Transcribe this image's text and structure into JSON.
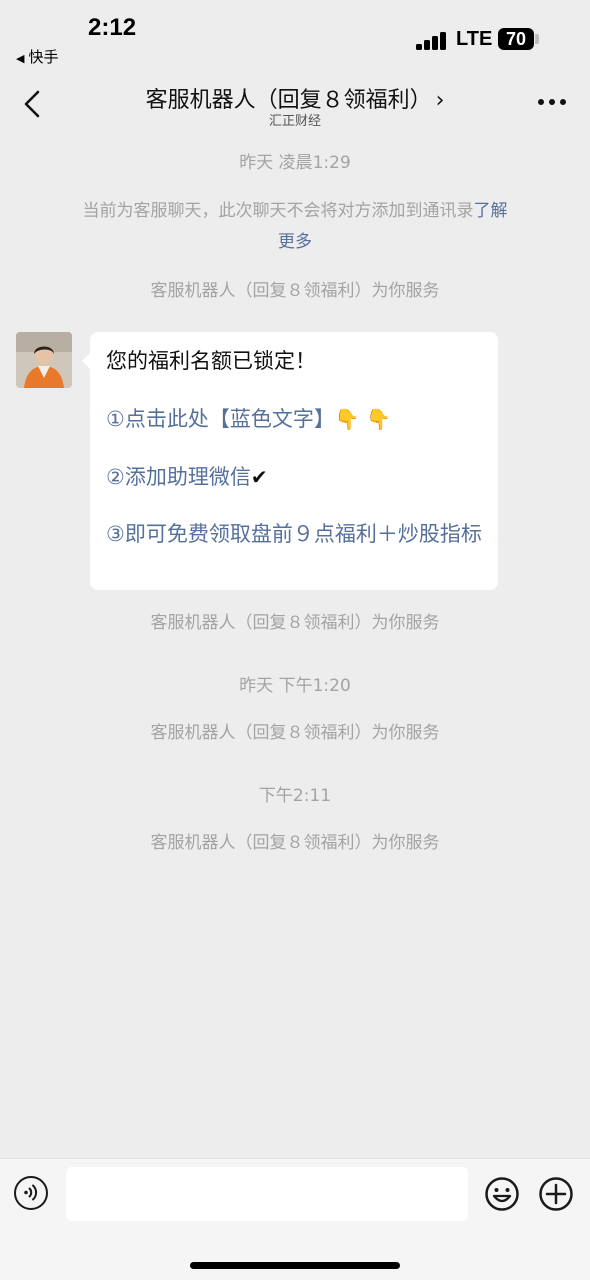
{
  "status_bar": {
    "time": "2:12",
    "back_app": "快手",
    "network": "LTE",
    "battery": "70"
  },
  "nav": {
    "title": "客服机器人（回复８领福利）",
    "chevron": "›",
    "subtitle": "汇正财经"
  },
  "chat": {
    "timestamp_1": "昨天 凌晨1:29",
    "notice_text": "当前为客服聊天，此次聊天不会将对方添加到通讯录",
    "notice_link_1": "了解",
    "notice_link_2": "更多",
    "service_note": "客服机器人（回复８领福利）为你服务",
    "message": {
      "line_1": "您的福利名额已锁定！",
      "line_2": "①点击此处【蓝色文字】",
      "line_2_emoji": "👇 👇",
      "line_3": "②添加助理微信",
      "line_3_emoji": "✔",
      "line_4": "③即可免费领取盘前９点福利＋炒股指标"
    },
    "timestamp_2": "昨天 下午1:20",
    "timestamp_3": "下午2:11"
  },
  "icons": {
    "back": "chevron-left-icon",
    "more": "more-dots-icon",
    "voice": "voice-icon",
    "emoji": "emoji-icon",
    "plus": "plus-icon"
  },
  "colors": {
    "background": "#ededed",
    "link": "#56709c",
    "system_text": "#a3a3a3"
  }
}
